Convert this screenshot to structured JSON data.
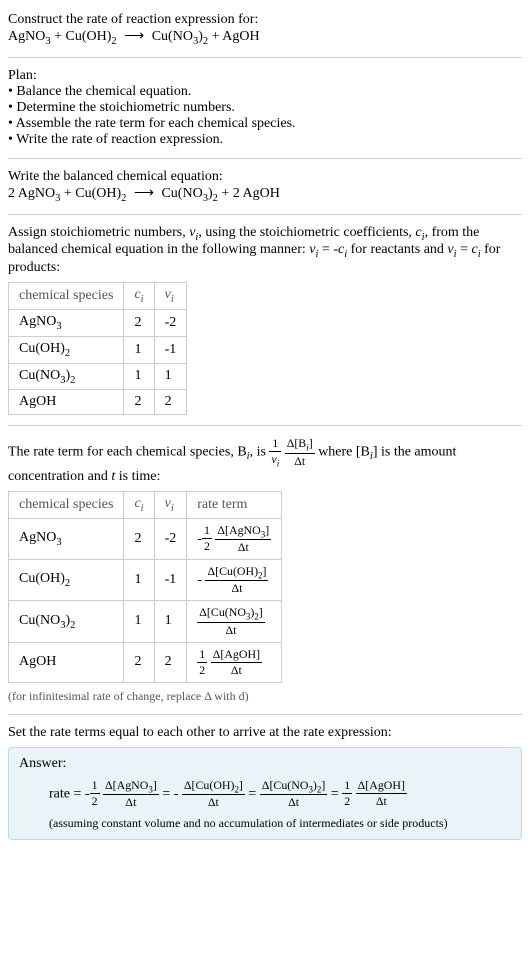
{
  "intro": {
    "title": "Construct the rate of reaction expression for:",
    "eq_lhs1": "AgNO",
    "eq_lhs1_sub": "3",
    "eq_lhs2": "Cu(OH)",
    "eq_lhs2_sub": "2",
    "eq_rhs1": "Cu(NO",
    "eq_rhs1_sub": "3",
    "eq_rhs1_close": ")",
    "eq_rhs1_sub2": "2",
    "eq_rhs2": "AgOH"
  },
  "plan": {
    "title": "Plan:",
    "b1": "Balance the chemical equation.",
    "b2": "Determine the stoichiometric numbers.",
    "b3": "Assemble the rate term for each chemical species.",
    "b4": "Write the rate of reaction expression."
  },
  "balanced": {
    "title": "Write the balanced chemical equation:",
    "c1": "2",
    "c2": "2"
  },
  "assign": {
    "text1": "Assign stoichiometric numbers, ",
    "nu": "ν",
    "text2": ", using the stoichiometric coefficients, ",
    "c": "c",
    "text3": ", from the balanced chemical equation in the following manner: ",
    "rel1": " = -",
    "text4": " for reactants and ",
    "rel2": " = ",
    "text5": " for products:"
  },
  "table1": {
    "h1": "chemical species",
    "h2": "c",
    "h3": "ν",
    "rows": [
      {
        "sp": "AgNO",
        "sp_sub": "3",
        "c": "2",
        "nu": "-2"
      },
      {
        "sp": "Cu(OH)",
        "sp_sub": "2",
        "c": "1",
        "nu": "-1"
      },
      {
        "sp": "Cu(NO",
        "sp_sub": "3",
        "sp_close": ")",
        "sp_sub2": "2",
        "c": "1",
        "nu": "1"
      },
      {
        "sp": "AgOH",
        "c": "2",
        "nu": "2"
      }
    ]
  },
  "rateterm": {
    "text1": "The rate term for each chemical species, B",
    "text2": ", is ",
    "text3": " where [B",
    "text4": "] is the amount concentration and ",
    "text5": " is time:",
    "i": "i",
    "t": "t",
    "one": "1",
    "nu": "ν",
    "delta": "Δ",
    "dnum": "Δ[B",
    "dnum2": "]",
    "dden": "Δt"
  },
  "table2": {
    "h1": "chemical species",
    "h2": "c",
    "h3": "ν",
    "h4": "rate term",
    "rows": [
      {
        "sp": "AgNO",
        "sp_sub": "3",
        "c": "2",
        "nu": "-2",
        "neg": "-",
        "coef_num": "1",
        "coef_den": "2",
        "br": "AgNO",
        "br_sub": "3"
      },
      {
        "sp": "Cu(OH)",
        "sp_sub": "2",
        "c": "1",
        "nu": "-1",
        "neg": "-",
        "br": "Cu(OH)",
        "br_sub": "2"
      },
      {
        "sp": "Cu(NO",
        "sp_sub": "3",
        "sp_close": ")",
        "sp_sub2": "2",
        "c": "1",
        "nu": "1",
        "br": "Cu(NO",
        "br_sub": "3",
        "br_close": ")",
        "br_sub2": "2"
      },
      {
        "sp": "AgOH",
        "c": "2",
        "nu": "2",
        "coef_num": "1",
        "coef_den": "2",
        "br": "AgOH"
      }
    ],
    "dt": "Δt",
    "D": "Δ"
  },
  "infinitesimal": "(for infinitesimal rate of change, replace Δ with d)",
  "final": {
    "text": "Set the rate terms equal to each other to arrive at the rate expression:"
  },
  "answer": {
    "label": "Answer:",
    "rate": "rate",
    "eq": " = ",
    "neg": "-",
    "half_num": "1",
    "half_den": "2",
    "D": "Δ",
    "dt": "Δt",
    "sp1": "AgNO",
    "sp1_sub": "3",
    "sp2": "Cu(OH)",
    "sp2_sub": "2",
    "sp3": "Cu(NO",
    "sp3_sub": "3",
    "sp3_close": ")",
    "sp3_sub2": "2",
    "sp4": "AgOH",
    "note": "(assuming constant volume and no accumulation of intermediates or side products)"
  }
}
